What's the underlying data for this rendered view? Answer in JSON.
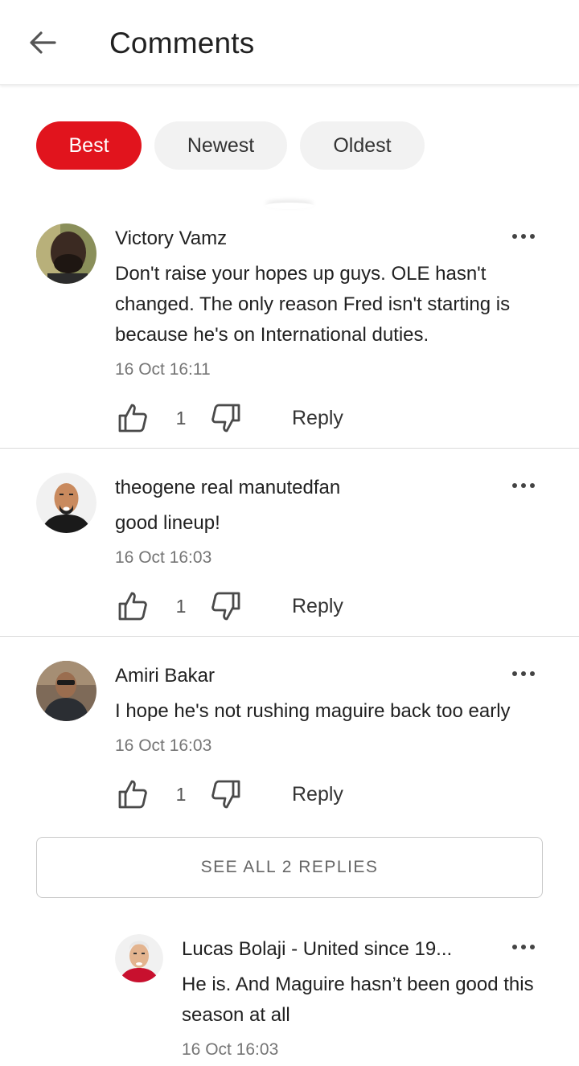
{
  "header": {
    "title": "Comments"
  },
  "sort_tabs": [
    {
      "label": "Best",
      "active": true
    },
    {
      "label": "Newest",
      "active": false
    },
    {
      "label": "Oldest",
      "active": false
    }
  ],
  "comments": [
    {
      "author": "Victory Vamz",
      "text": "Don't raise your hopes up guys. OLE hasn't changed. The only reason Fred isn't starting is because he's on International duties.",
      "time": "16 Oct 16:11",
      "likes": "1",
      "reply_label": "Reply"
    },
    {
      "author": "theogene real manutedfan",
      "text": "good lineup!",
      "time": "16 Oct 16:03",
      "likes": "1",
      "reply_label": "Reply"
    },
    {
      "author": "Amiri Bakar",
      "text": "I hope he's not rushing maguire back too early",
      "time": "16 Oct 16:03",
      "likes": "1",
      "reply_label": "Reply"
    }
  ],
  "see_all_replies": "SEE ALL 2 REPLIES",
  "reply": {
    "author": "Lucas Bolaji - United since 19...",
    "text": "He is. And Maguire hasn’t been good this season at all",
    "time": "16 Oct 16:03"
  },
  "colors": {
    "accent": "#e1141d",
    "pill_inactive": "#f2f2f2",
    "timestamp": "#757575"
  },
  "icons": [
    "back-arrow-icon",
    "more-options-icon",
    "thumbs-up-icon",
    "thumbs-down-icon"
  ]
}
